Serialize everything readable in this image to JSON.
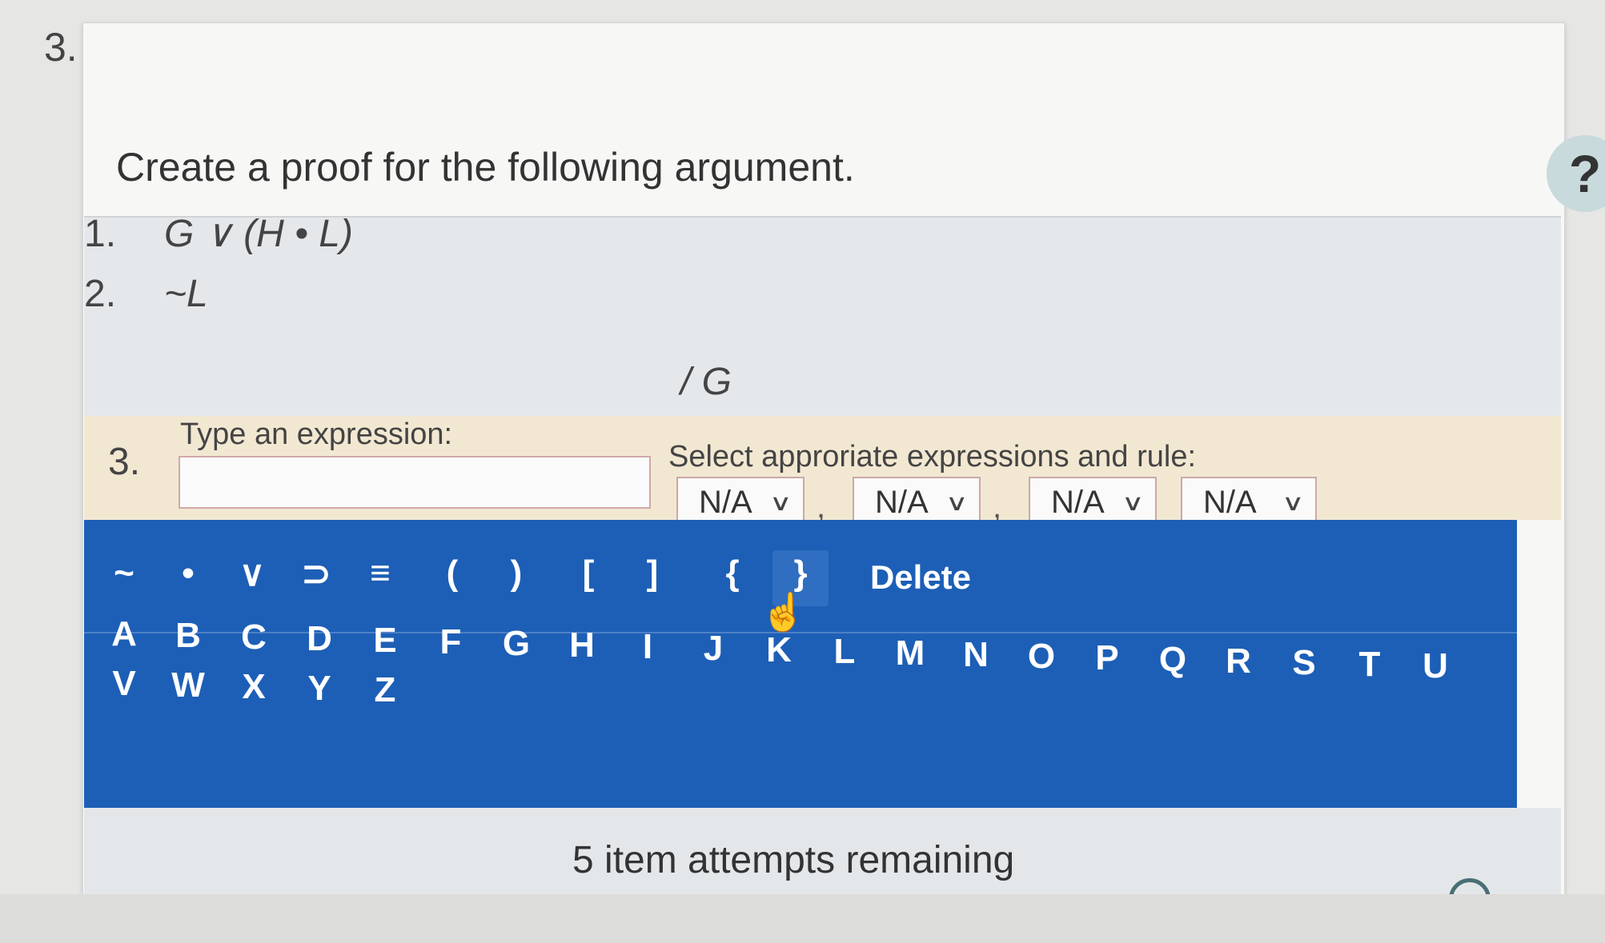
{
  "question_number": "3.",
  "prompt": "Create a proof for the following argument.",
  "help_label": "?",
  "premises": [
    {
      "number": "1.",
      "expression": "G ∨ (H • L)"
    },
    {
      "number": "2.",
      "expression": "~L"
    }
  ],
  "conclusion": "/ G",
  "input_line": {
    "number": "3.",
    "expression_label": "Type an expression:",
    "expression_value": "",
    "rule_label": "Select approriate expressions and rule:",
    "selects": [
      "N/A",
      "N/A",
      "N/A",
      "N/A"
    ],
    "separator": ","
  },
  "keyboard": {
    "symbols": [
      "~",
      "•",
      "∨",
      "⊃",
      "≡",
      "(",
      ")",
      "[",
      "]",
      "{",
      "}"
    ],
    "delete_label": "Delete",
    "letters_row1": [
      "A",
      "B",
      "C",
      "D",
      "E",
      "F",
      "G",
      "H",
      "I",
      "J",
      "K",
      "L",
      "M",
      "N",
      "O",
      "P",
      "Q",
      "R",
      "S",
      "T",
      "U"
    ],
    "letters_row2": [
      "V",
      "W",
      "X",
      "Y",
      "Z"
    ]
  },
  "attempts_text": "5 item attempts remaining",
  "colors": {
    "keyboard_bg": "#1d5fb6",
    "input_row_bg": "#f2e8d2",
    "premises_bg": "#e5e8eb",
    "help_bg": "#c8dadb"
  },
  "icons": {
    "cursor": "hand-pointer-icon",
    "dropdown": "chevron-down-icon",
    "status": "circle-icon"
  }
}
